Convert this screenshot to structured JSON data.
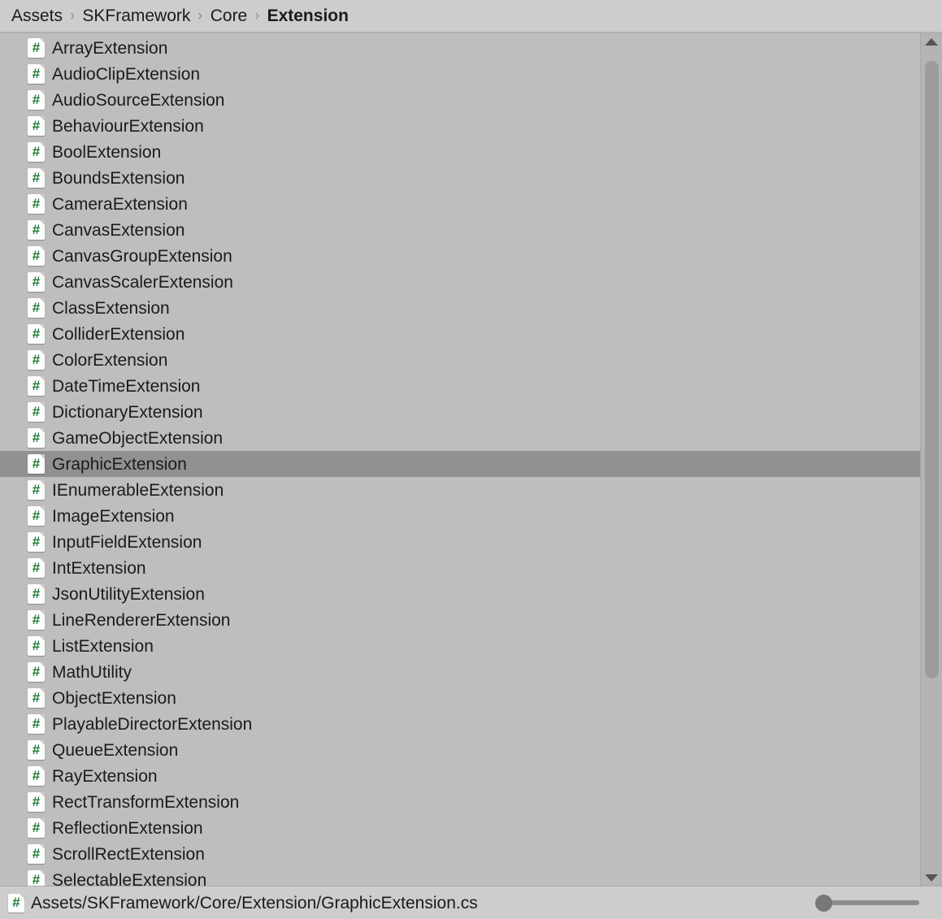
{
  "breadcrumb": {
    "separator": "›",
    "items": [
      {
        "label": "Assets",
        "current": false
      },
      {
        "label": "SKFramework",
        "current": false
      },
      {
        "label": "Core",
        "current": false
      },
      {
        "label": "Extension",
        "current": true
      }
    ]
  },
  "assets": {
    "icon_glyph": "#",
    "icon_name": "csharp-script-icon",
    "selected": "GraphicExtension",
    "items": [
      {
        "name": "ArrayExtension",
        "selected": false
      },
      {
        "name": "AudioClipExtension",
        "selected": false
      },
      {
        "name": "AudioSourceExtension",
        "selected": false
      },
      {
        "name": "BehaviourExtension",
        "selected": false
      },
      {
        "name": "BoolExtension",
        "selected": false
      },
      {
        "name": "BoundsExtension",
        "selected": false
      },
      {
        "name": "CameraExtension",
        "selected": false
      },
      {
        "name": "CanvasExtension",
        "selected": false
      },
      {
        "name": "CanvasGroupExtension",
        "selected": false
      },
      {
        "name": "CanvasScalerExtension",
        "selected": false
      },
      {
        "name": "ClassExtension",
        "selected": false
      },
      {
        "name": "ColliderExtension",
        "selected": false
      },
      {
        "name": "ColorExtension",
        "selected": false
      },
      {
        "name": "DateTimeExtension",
        "selected": false
      },
      {
        "name": "DictionaryExtension",
        "selected": false
      },
      {
        "name": "GameObjectExtension",
        "selected": false
      },
      {
        "name": "GraphicExtension",
        "selected": true
      },
      {
        "name": "IEnumerableExtension",
        "selected": false
      },
      {
        "name": "ImageExtension",
        "selected": false
      },
      {
        "name": "InputFieldExtension",
        "selected": false
      },
      {
        "name": "IntExtension",
        "selected": false
      },
      {
        "name": "JsonUtilityExtension",
        "selected": false
      },
      {
        "name": "LineRendererExtension",
        "selected": false
      },
      {
        "name": "ListExtension",
        "selected": false
      },
      {
        "name": "MathUtility",
        "selected": false
      },
      {
        "name": "ObjectExtension",
        "selected": false
      },
      {
        "name": "PlayableDirectorExtension",
        "selected": false
      },
      {
        "name": "QueueExtension",
        "selected": false
      },
      {
        "name": "RayExtension",
        "selected": false
      },
      {
        "name": "RectTransformExtension",
        "selected": false
      },
      {
        "name": "ReflectionExtension",
        "selected": false
      },
      {
        "name": "ScrollRectExtension",
        "selected": false
      },
      {
        "name": "SelectableExtension",
        "selected": false
      }
    ]
  },
  "scrollbar": {
    "up_arrow_name": "scroll-up-arrow",
    "down_arrow_name": "scroll-down-arrow"
  },
  "status_bar": {
    "path": "Assets/SKFramework/Core/Extension/GraphicExtension.cs",
    "icon_glyph": "#"
  },
  "colors": {
    "breadcrumb_bg": "#cdcdcd",
    "list_bg": "#bebebe",
    "selected_row_bg": "#919191",
    "text": "#1b1b1b",
    "separator": "#8d8d8d",
    "icon_hash": "#1e7a32",
    "icon_bg": "#fdfdfd",
    "scrollbar_track": "#b4b4b4",
    "scrollbar_thumb": "#9c9c9c",
    "slider_track": "#8c8c8c",
    "slider_knob": "#787878"
  }
}
